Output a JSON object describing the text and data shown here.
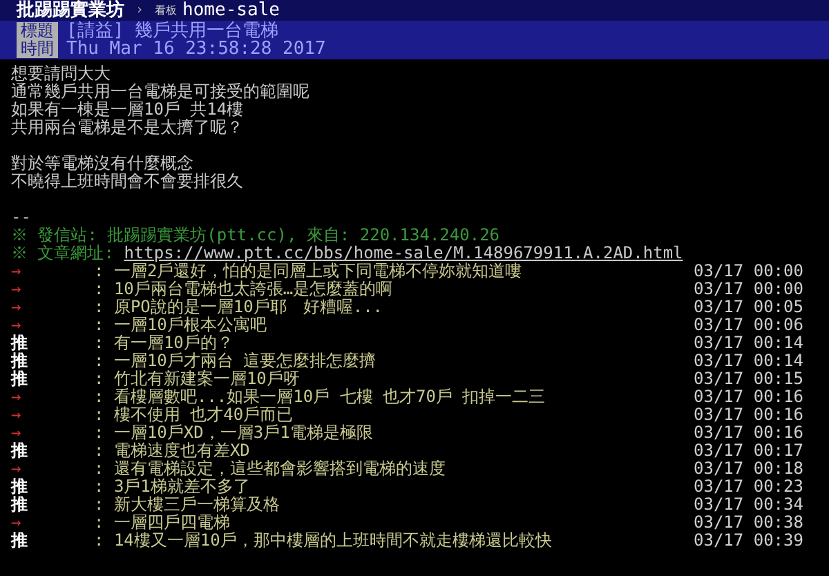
{
  "header": {
    "site": "批踢踢實業坊",
    "separator": "›",
    "board_label": "看板",
    "board": "home-sale"
  },
  "meta": [
    {
      "label": "標題",
      "value": "[請益] 幾戶共用一台電梯"
    },
    {
      "label": "時間",
      "value": "Thu Mar 16 23:58:28 2017"
    }
  ],
  "body": [
    [
      "想要請問大大",
      "通常幾戶共用一台電梯是可接受的範圍呢",
      "如果有一棟是一層10戶 共14樓",
      "共用兩台電梯是不是太擠了呢？"
    ],
    [
      "對於等電梯沒有什麼概念",
      "不曉得上班時間會不會要排很久"
    ],
    [
      "--"
    ]
  ],
  "signature": {
    "origin": "※ 發信站: 批踢踢實業坊(ptt.cc), 來自: 220.134.240.26",
    "url_label": "※ 文章網址: ",
    "url": "https://www.ptt.cc/bbs/home-sale/M.1489679911.A.2AD.html"
  },
  "comments": [
    {
      "kind": "arrow",
      "tag": "→",
      "text": ": 一層2戶還好，怕的是同層上或下同電梯不停妳就知道嘍",
      "time": "03/17 00:00"
    },
    {
      "kind": "arrow",
      "tag": "→",
      "text": ": 10戶兩台電梯也太誇張…是怎麼蓋的啊",
      "time": "03/17 00:00"
    },
    {
      "kind": "arrow",
      "tag": "→",
      "text": ": 原PO說的是一層10戶耶　好糟喔...",
      "time": "03/17 00:05"
    },
    {
      "kind": "arrow",
      "tag": "→",
      "text": ": 一層10戶根本公寓吧",
      "time": "03/17 00:06"
    },
    {
      "kind": "push",
      "tag": "推",
      "text": ": 有一層10戶的？",
      "time": "03/17 00:14"
    },
    {
      "kind": "push",
      "tag": "推",
      "text": ": 一層10戶才兩台 這要怎麼排怎麼擠",
      "time": "03/17 00:14"
    },
    {
      "kind": "push",
      "tag": "推",
      "text": ": 竹北有新建案一層10戶呀",
      "time": "03/17 00:15"
    },
    {
      "kind": "arrow",
      "tag": "→",
      "text": ": 看樓層數吧...如果一層10戶 七樓 也才70戶 扣掉一二三",
      "time": "03/17 00:16"
    },
    {
      "kind": "arrow",
      "tag": "→",
      "text": ": 樓不使用 也才40戶而已",
      "time": "03/17 00:16"
    },
    {
      "kind": "arrow",
      "tag": "→",
      "text": ": 一層10戶XD，一層3戶1電梯是極限",
      "time": "03/17 00:16"
    },
    {
      "kind": "push",
      "tag": "推",
      "text": ": 電梯速度也有差XD",
      "time": "03/17 00:17"
    },
    {
      "kind": "arrow",
      "tag": "→",
      "text": ": 還有電梯設定，這些都會影響搭到電梯的速度",
      "time": "03/17 00:18"
    },
    {
      "kind": "push",
      "tag": "推",
      "text": ": 3戶1梯就差不多了",
      "time": "03/17 00:23"
    },
    {
      "kind": "push",
      "tag": "推",
      "text": ": 新大樓三戶一梯算及格",
      "time": "03/17 00:34"
    },
    {
      "kind": "arrow",
      "tag": "→",
      "text": ": 一層四戶四電梯",
      "time": "03/17 00:38"
    },
    {
      "kind": "push",
      "tag": "推",
      "text": ": 14樓又一層10戶，那中樓層的上班時間不就走樓梯還比較快",
      "time": "03/17 00:39"
    }
  ]
}
